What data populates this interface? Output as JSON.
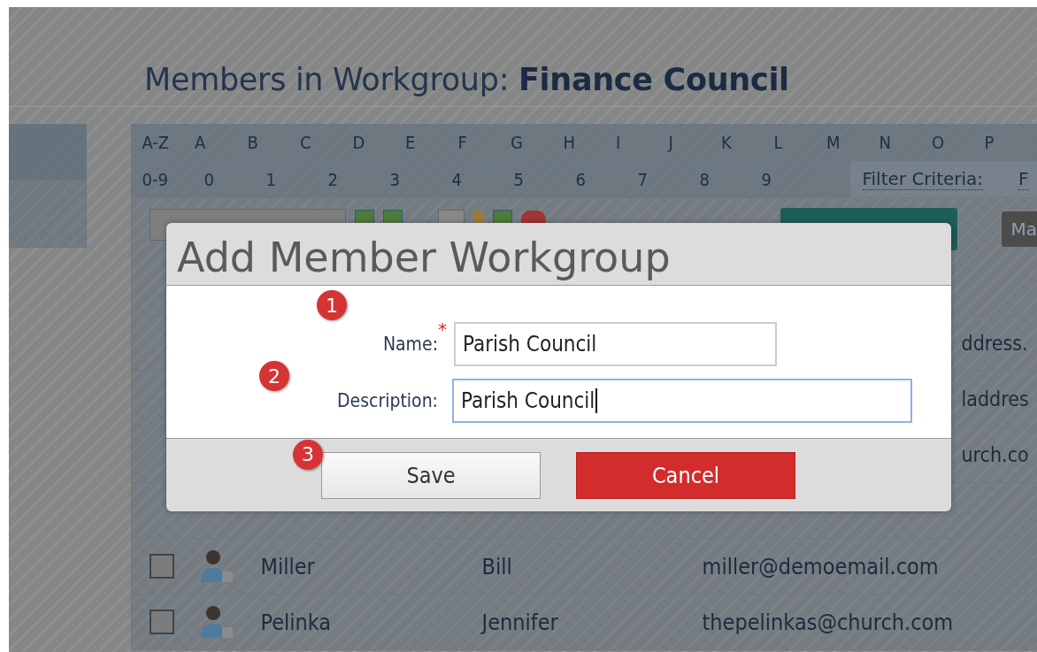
{
  "page_title": "Members in Workgroup: **Finance Council**",
  "letter_filter": [
    "A-Z",
    "A",
    "B",
    "C",
    "D",
    "E",
    "F",
    "G",
    "H",
    "I",
    "J",
    "K",
    "L",
    "M",
    "N",
    "O",
    "P"
  ],
  "digit_filter": [
    "0-9",
    "0",
    "1",
    "2",
    "3",
    "4",
    "5",
    "6",
    "7",
    "8",
    "9"
  ],
  "filter_criteria": {
    "label": "Filter Criteria:",
    "value": "F"
  },
  "toolbar": {
    "buttons": [
      {
        "label": "Ma"
      }
    ]
  },
  "table": {
    "rows": [
      {
        "kind": "covered",
        "email": "ddress."
      },
      {
        "kind": "covered",
        "email": "laddres"
      },
      {
        "kind": "covered",
        "email": "urch.co"
      },
      {
        "kind": "under"
      },
      {
        "kind": "full",
        "checked": false,
        "last_name": "Miller",
        "first_name": "Bill",
        "email": "miller@demoemail.com"
      },
      {
        "kind": "full",
        "checked": false,
        "last_name": "Pelinka",
        "first_name": "Jennifer",
        "email": "thepelinkas@church.com"
      }
    ]
  },
  "dialog": {
    "title": "Add Member Workgroup",
    "fields": [
      {
        "step": "1",
        "label": "Name:",
        "required_mark": "*",
        "value": "Parish Council",
        "focused": false
      },
      {
        "step": "2",
        "label": "Description:",
        "value": "Parish Council",
        "focused": true
      }
    ],
    "buttons": [
      {
        "step": "3",
        "label": "Save",
        "kind": "default"
      },
      {
        "label": "Cancel",
        "kind": "danger"
      }
    ]
  }
}
